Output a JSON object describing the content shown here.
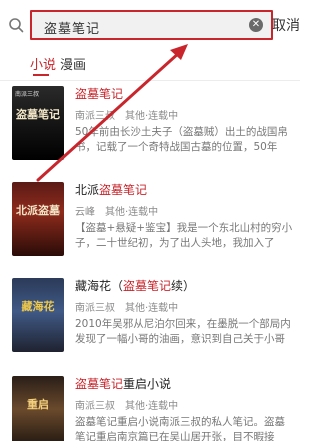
{
  "search": {
    "query": "盗墓笔记",
    "cancel_label": "取消"
  },
  "tabs": [
    {
      "label": "小说"
    },
    {
      "label": "漫画"
    }
  ],
  "colors": {
    "accent": "#c8262c"
  },
  "results": [
    {
      "cover_text": "盗墓笔记",
      "cover_badge": "南派三叔",
      "title_parts": [
        "",
        "盗墓笔记",
        ""
      ],
      "author": "南派三叔",
      "category": "其他·连载中",
      "desc": "50年前由长沙土夫子（盗墓贼）出土的战国帛书，记载了一个奇特战国古墓的位置，50年后，"
    },
    {
      "cover_text": "北派盗墓",
      "cover_badge": "",
      "title_parts": [
        "北派",
        "盗墓笔记",
        ""
      ],
      "author": "云峰",
      "category": "其他·连载中",
      "desc": "【盗墓+悬疑+鉴宝】我是一个东北山村的穷小子，二十世纪初，为了出人头地，我加入了"
    },
    {
      "cover_text": "藏海花",
      "cover_badge": "",
      "title_parts": [
        "藏海花（",
        "盗墓笔记",
        "续）"
      ],
      "author": "南派三叔",
      "category": "其他·连载中",
      "desc": "2010年吴邪从尼泊尔回来，在墨脱一个部局内发现了一幅小哥的油画，意识到自己关于小哥"
    },
    {
      "cover_text": "重启",
      "cover_badge": "",
      "title_parts": [
        "",
        "盗墓笔记",
        "重启小说"
      ],
      "author": "南派三叔",
      "category": "其他·连载中",
      "desc": "盗墓笔记重启小说南派三叔的私人笔记。盗墓笔记重启南京篇已在吴山居开张，目不暇接"
    }
  ]
}
